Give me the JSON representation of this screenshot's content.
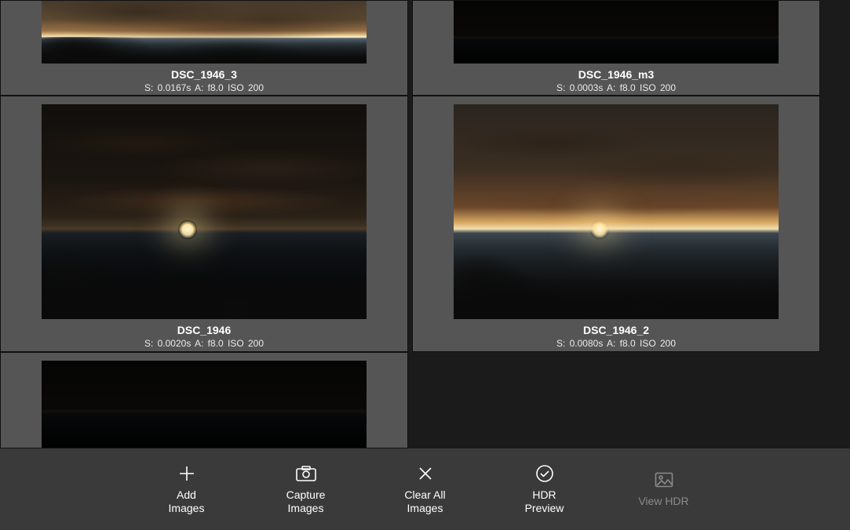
{
  "thumbnails": [
    {
      "name": "DSC_1946_3",
      "meta": "S: 0.0167s  A: f8.0  ISO 200",
      "variant": "bright"
    },
    {
      "name": "DSC_1946_m3",
      "meta": "S: 0.0003s  A: f8.0  ISO 200",
      "variant": "darker"
    },
    {
      "name": "DSC_1946",
      "meta": "S: 0.0020s  A: f8.0  ISO 200",
      "variant": "dark"
    },
    {
      "name": "DSC_1946_2",
      "meta": "S: 0.0080s  A: f8.0  ISO 200",
      "variant": "normal"
    },
    {
      "name": "",
      "meta": "",
      "variant": "darker"
    }
  ],
  "toolbar": {
    "add": {
      "line1": "Add",
      "line2": "Images"
    },
    "capture": {
      "line1": "Capture",
      "line2": "Images"
    },
    "clear": {
      "line1": "Clear All",
      "line2": "Images"
    },
    "hdr": {
      "line1": "HDR",
      "line2": "Preview"
    },
    "view": {
      "line1": "View HDR",
      "line2": ""
    }
  }
}
